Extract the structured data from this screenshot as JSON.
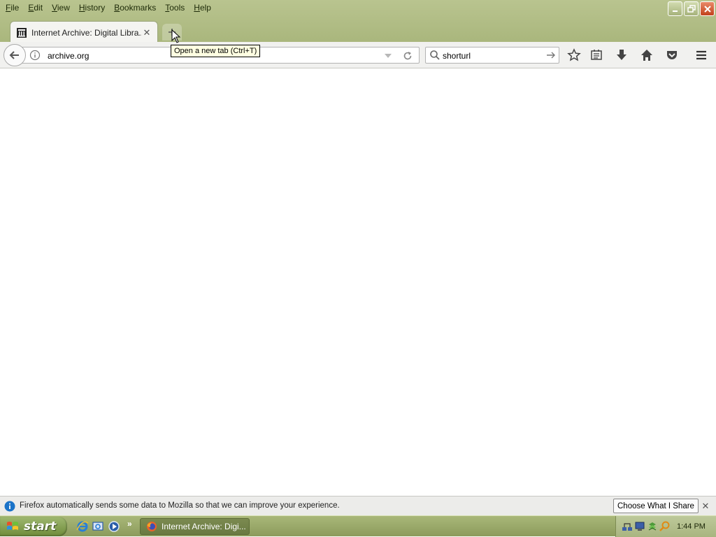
{
  "menubar": {
    "items": [
      {
        "label": "File",
        "u": "F",
        "rest": "ile"
      },
      {
        "label": "Edit",
        "u": "E",
        "rest": "dit"
      },
      {
        "label": "View",
        "u": "V",
        "rest": "iew"
      },
      {
        "label": "History",
        "u": "H",
        "rest": "istory"
      },
      {
        "label": "Bookmarks",
        "u": "B",
        "rest": "ookmarks"
      },
      {
        "label": "Tools",
        "u": "T",
        "rest": "ools"
      },
      {
        "label": "Help",
        "u": "H",
        "rest": "elp"
      }
    ]
  },
  "tabs": [
    {
      "title": "Internet Archive: Digital Libra...",
      "favicon": "archive-building-icon",
      "active": true
    }
  ],
  "tooltip": {
    "text": "Open a new tab (Ctrl+T)"
  },
  "navbar": {
    "url": "archive.org",
    "search_value": "shorturl"
  },
  "toolbar_icons": [
    "star-icon",
    "reading-list-icon",
    "download-icon",
    "home-icon",
    "pocket-icon",
    "hamburger-menu-icon"
  ],
  "notification": {
    "text": "Firefox automatically sends some data to Mozilla so that we can improve your experience.",
    "button": "Choose What I Share"
  },
  "taskbar": {
    "start_label": "start",
    "task_label": "Internet Archive: Digi...",
    "clock": "1:44 PM"
  },
  "colors": {
    "frame": "#b9c48f",
    "taskbar": "#a9b779",
    "start": "#6e8b3a"
  }
}
